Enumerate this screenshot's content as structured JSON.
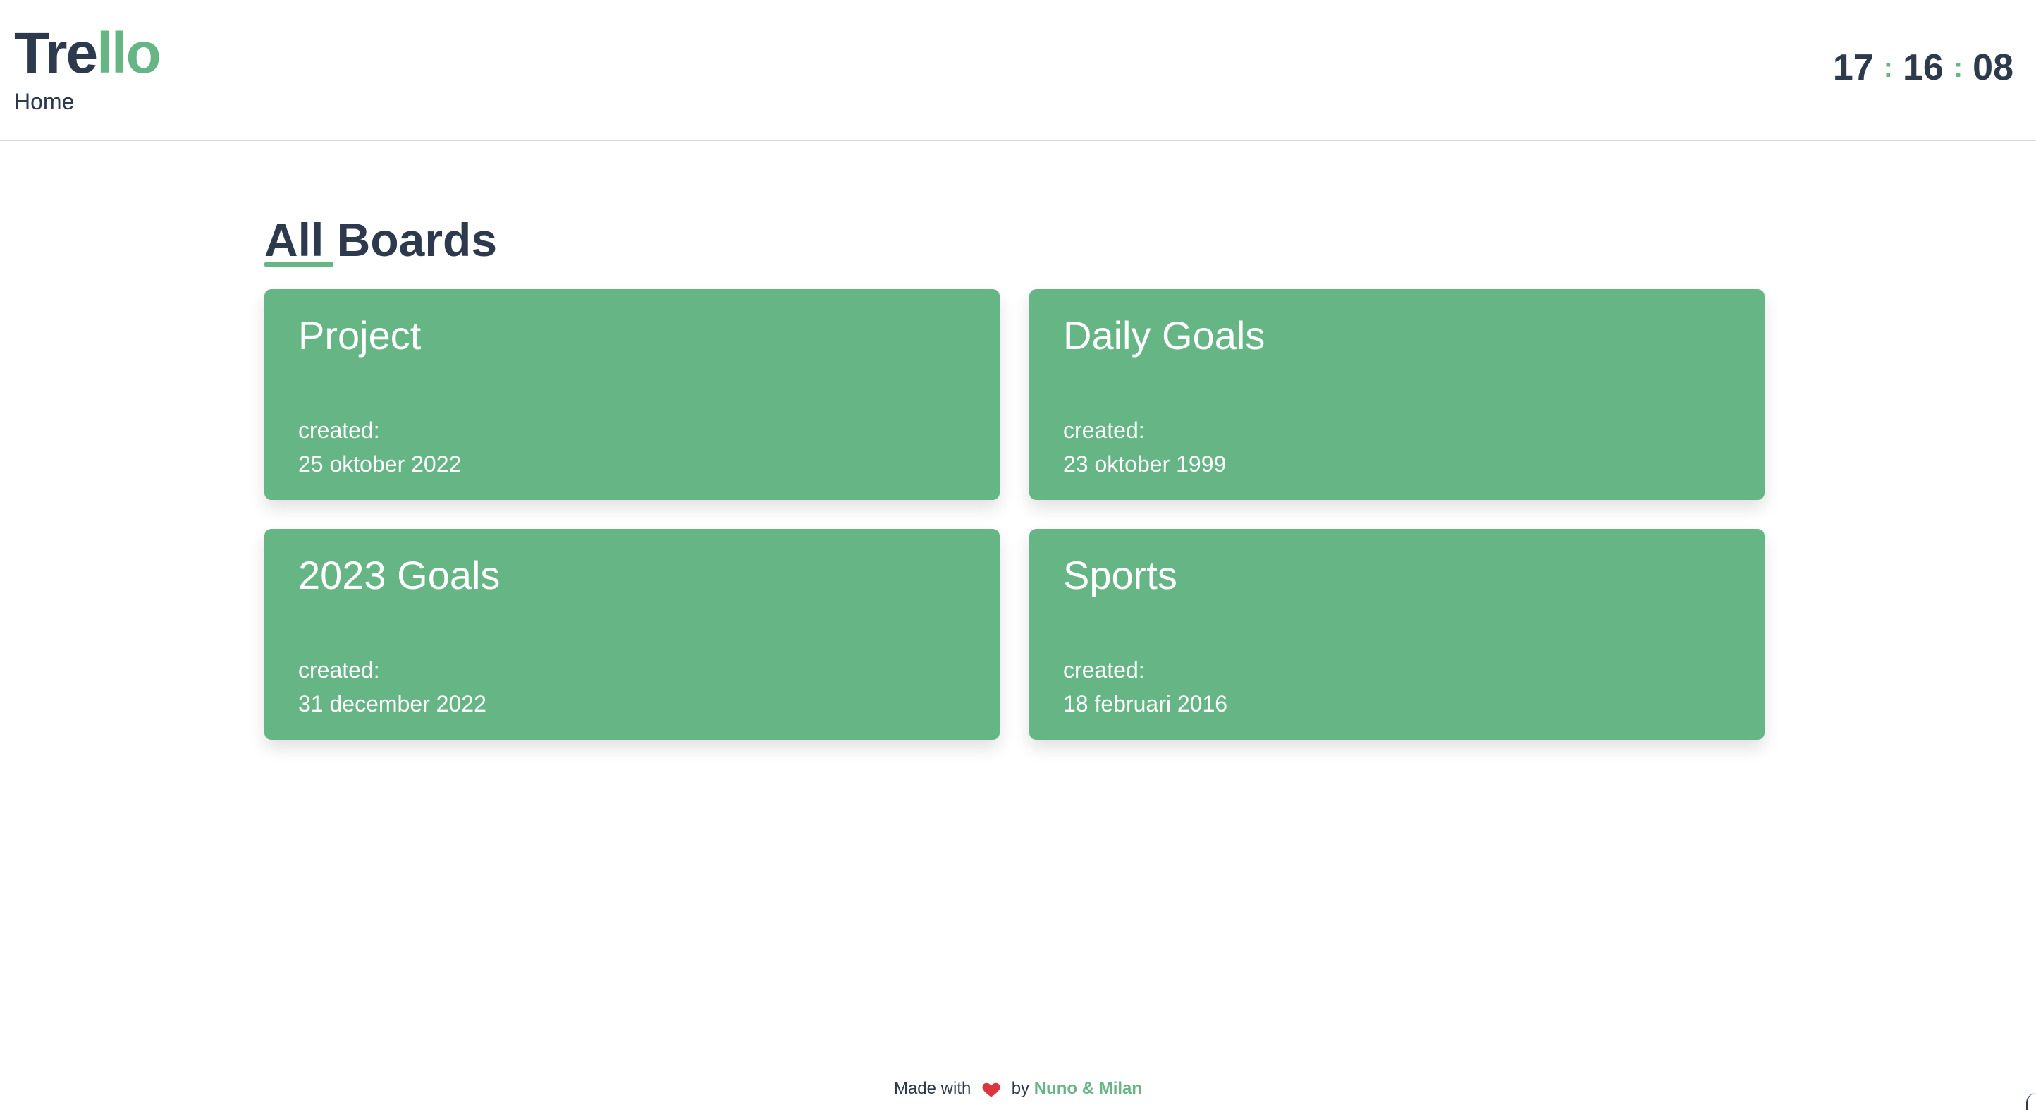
{
  "header": {
    "logo_part1": "Tre",
    "logo_part2": "llo",
    "breadcrumb": "Home",
    "clock": {
      "hours": "17",
      "minutes": "16",
      "seconds": "08",
      "separator": ":"
    }
  },
  "main": {
    "section_title": "All Boards",
    "boards": [
      {
        "title": "Project",
        "created_label": "created:",
        "created_date": "25 oktober 2022"
      },
      {
        "title": "Daily Goals",
        "created_label": "created:",
        "created_date": "23 oktober 1999"
      },
      {
        "title": "2023 Goals",
        "created_label": "created:",
        "created_date": "31 december 2022"
      },
      {
        "title": "Sports",
        "created_label": "created:",
        "created_date": "18 februari 2016"
      }
    ]
  },
  "footer": {
    "made_with": "Made with",
    "heart_icon": "heart-icon",
    "by": "by",
    "authors": "Nuno & Milan"
  },
  "colors": {
    "accent": "#65b585",
    "text": "#2d3a4e",
    "heart": "#d9363e"
  }
}
